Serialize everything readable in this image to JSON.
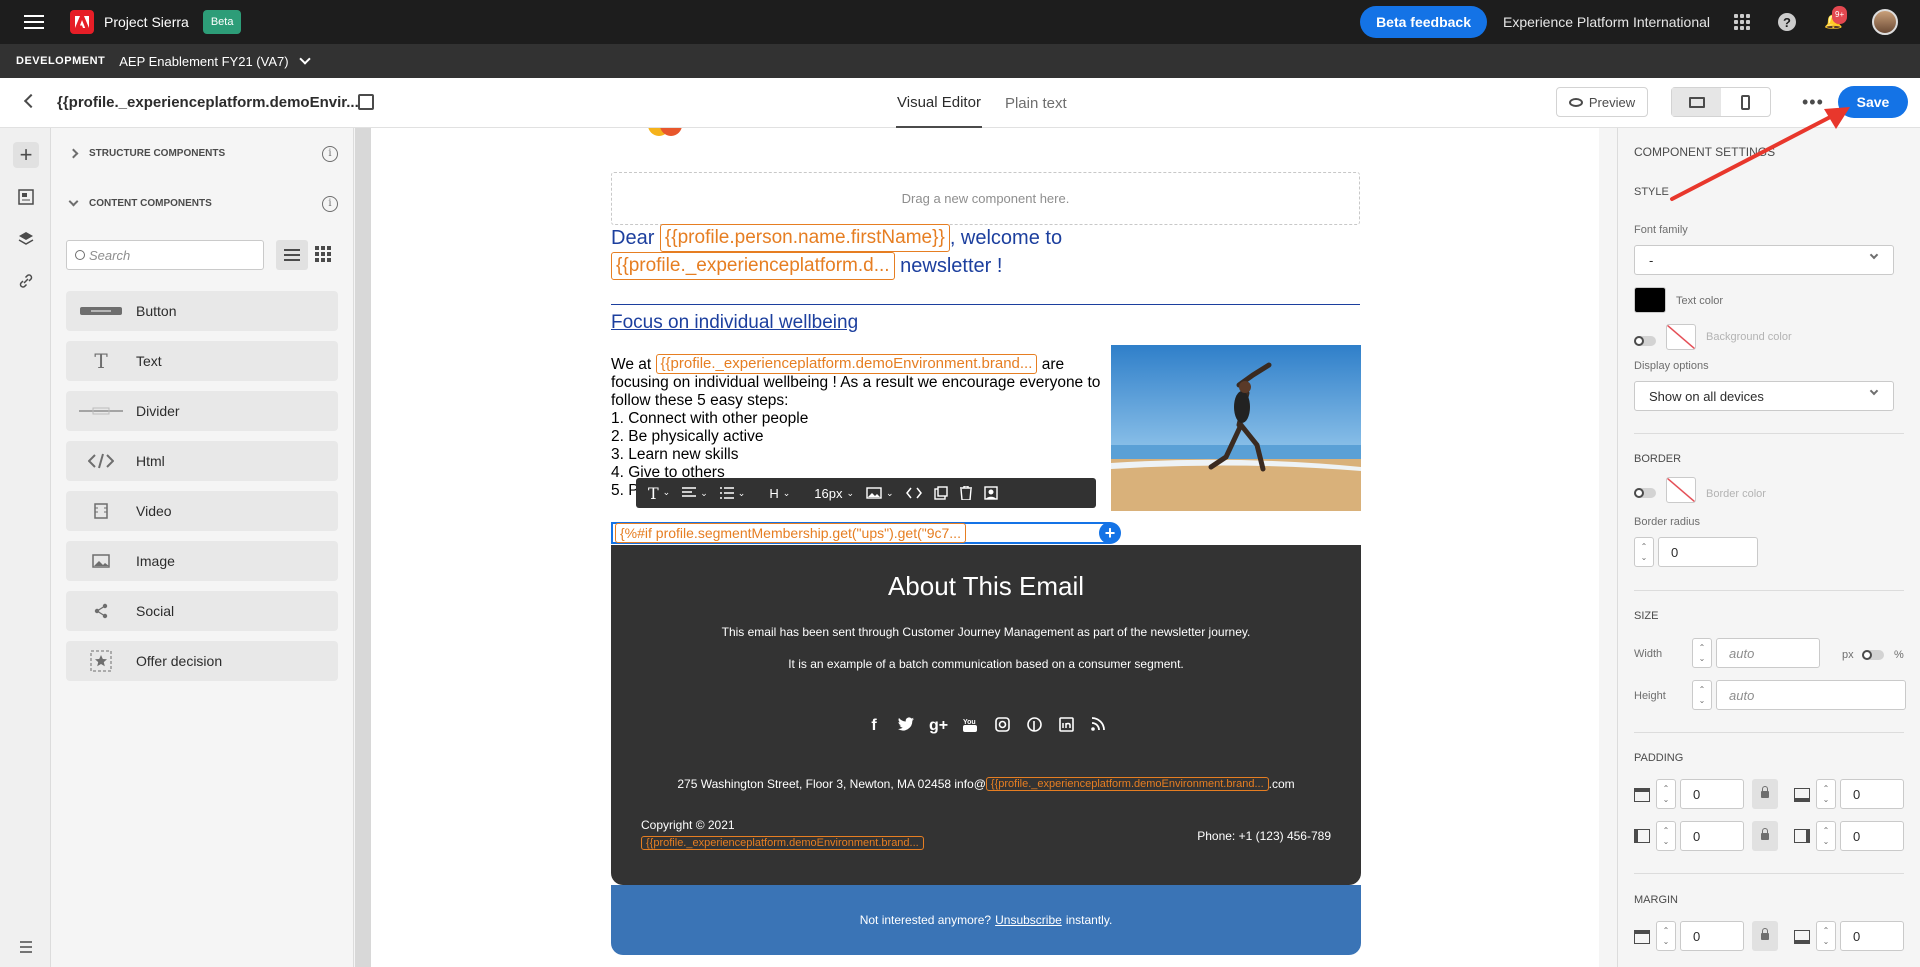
{
  "topbar": {
    "app_name": "Project Sierra",
    "beta_badge": "Beta",
    "beta_feedback": "Beta feedback",
    "org_name": "Experience Platform International",
    "notification_count": "9+"
  },
  "envbar": {
    "env_label": "DEVELOPMENT",
    "sandbox_name": "AEP Enablement FY21 (VA7)"
  },
  "editorbar": {
    "doc_title": "{{profile._experienceplatform.demoEnvir...",
    "tab_visual": "Visual Editor",
    "tab_plain": "Plain text",
    "preview": "Preview",
    "more": "•••",
    "save": "Save"
  },
  "leftpanel": {
    "structure_components": "STRUCTURE COMPONENTS",
    "content_components": "CONTENT COMPONENTS",
    "search_placeholder": "Search",
    "components": [
      {
        "label": "Button",
        "icon": "button-icon"
      },
      {
        "label": "Text",
        "icon": "text-icon"
      },
      {
        "label": "Divider",
        "icon": "divider-icon"
      },
      {
        "label": "Html",
        "icon": "code-icon"
      },
      {
        "label": "Video",
        "icon": "video-icon"
      },
      {
        "label": "Image",
        "icon": "image-icon"
      },
      {
        "label": "Social",
        "icon": "share-icon"
      },
      {
        "label": "Offer decision",
        "icon": "offer-icon"
      }
    ]
  },
  "email": {
    "dropzone": "Drag a new component here.",
    "greet_dear": "Dear",
    "greet_token_name": "{{profile.person.name.firstName}}",
    "greet_welcome": ", welcome to",
    "greet_token_brand": "{{profile._experienceplatform.d...",
    "greet_newsletter": "newsletter !",
    "heading": "Focus on individual wellbeing",
    "body_we_at": "We at",
    "body_token_brand": "{{profile._experienceplatform.demoEnvironment.brand...",
    "body_are": "are",
    "body_text": "focusing on individual wellbeing ! As a result we encourage everyone to follow these 5 easy steps:",
    "steps": [
      "1. Connect with other people",
      "2. Be physically active",
      "3. Learn new skills",
      "4. Give to others",
      "5. P"
    ],
    "toolbar_font_size": "16px",
    "toolbar_heading": "H",
    "cond_token": "{%#if profile.segmentMembership.get(\"ups\").get(\"9c7...",
    "footer_title": "About This Email",
    "footer_line1": "This email has been sent through Customer Journey Management as part of the newsletter journey.",
    "footer_line2": "It is an example of a batch communication based on a consumer segment.",
    "address_prefix": "275 Washington Street, Floor 3, Newton, MA 02458 info@",
    "address_token": "{{profile._experienceplatform.demoEnvironment.brand...",
    "address_suffix": ".com",
    "copyright": "Copyright © 2021",
    "copyright_token": "{{profile._experienceplatform.demoEnvironment.brand...",
    "phone": "Phone: +1 (123) 456-789",
    "unsub_prefix": "Not interested anymore?",
    "unsub_link": "Unsubscribe",
    "unsub_suffix": "instantly."
  },
  "rightpanel": {
    "title": "COMPONENT SETTINGS",
    "style": "STYLE",
    "font_family_label": "Font family",
    "font_family_value": "-",
    "text_color_label": "Text color",
    "text_color_value": "#000000",
    "background_color_label": "Background color",
    "display_options_label": "Display options",
    "display_options_value": "Show on all devices",
    "border": "BORDER",
    "border_color_label": "Border color",
    "border_radius_label": "Border radius",
    "border_radius_value": "0",
    "size": "SIZE",
    "width_label": "Width",
    "width_placeholder": "auto",
    "unit_px": "px",
    "unit_pct": "%",
    "height_label": "Height",
    "height_placeholder": "auto",
    "padding": "PADDING",
    "padding_top": "0",
    "padding_bottom": "0",
    "padding_left": "0",
    "padding_right": "0",
    "margin": "MARGIN",
    "margin_top": "0",
    "margin_bottom": "0"
  },
  "colors": {
    "accent": "#1473e6",
    "token_orange": "#e67e22",
    "email_blue": "#1c3f9e",
    "footer_dark": "#333333",
    "unsub_blue": "#3a74b6",
    "annotation_red": "#e8372c"
  }
}
